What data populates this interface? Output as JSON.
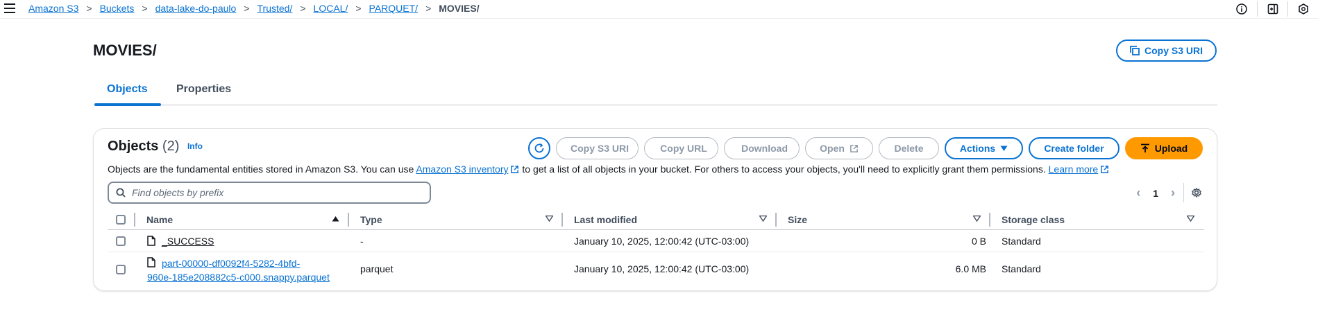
{
  "breadcrumbs": [
    {
      "label": "Amazon S3",
      "link": true
    },
    {
      "label": "Buckets",
      "link": true
    },
    {
      "label": "data-lake-do-paulo",
      "link": true
    },
    {
      "label": "Trusted/",
      "link": true
    },
    {
      "label": "LOCAL/",
      "link": true
    },
    {
      "label": "PARQUET/",
      "link": true
    },
    {
      "label": "MOVIES/",
      "link": false
    }
  ],
  "header": {
    "title": "MOVIES/",
    "copy_uri_label": "Copy S3 URI"
  },
  "tabs": [
    {
      "label": "Objects",
      "active": true
    },
    {
      "label": "Properties",
      "active": false
    }
  ],
  "objects": {
    "heading": "Objects",
    "count": "(2)",
    "info": "Info",
    "buttons": {
      "copy_s3_uri": "Copy S3 URI",
      "copy_url": "Copy URL",
      "download": "Download",
      "open": "Open",
      "delete": "Delete",
      "actions": "Actions",
      "create_folder": "Create folder",
      "upload": "Upload"
    },
    "description": {
      "part1": "Objects are the fundamental entities stored in Amazon S3. You can use ",
      "inventory_link": "Amazon S3 inventory",
      "part2": " to get a list of all objects in your bucket. For others to access your objects, you'll need to explicitly grant them permissions. ",
      "learn_more": "Learn more"
    },
    "search": {
      "placeholder": "Find objects by prefix",
      "value": ""
    },
    "pagination": {
      "page": "1"
    },
    "columns": {
      "name": "Name",
      "type": "Type",
      "last_modified": "Last modified",
      "size": "Size",
      "storage_class": "Storage class"
    },
    "rows": [
      {
        "name": "_SUCCESS",
        "type": "-",
        "last_modified": "January 10, 2025, 12:00:42 (UTC-03:00)",
        "size": "0 B",
        "storage_class": "Standard"
      },
      {
        "name_line1": "part-00000-df0092f4-5282-4bfd-",
        "name_line2": "960e-185e208882c5-c000.snappy.parquet",
        "type": "parquet",
        "last_modified": "January 10, 2025, 12:00:42 (UTC-03:00)",
        "size": "6.0 MB",
        "storage_class": "Standard"
      }
    ]
  },
  "icons": {
    "menu": "hamburger-icon",
    "info": "info-circle-icon",
    "notifications": "notification-panel-icon",
    "settings_top": "hexagon-settings-icon",
    "copy": "copy-icon",
    "refresh": "refresh-icon",
    "download": "download-icon",
    "external": "external-link-icon",
    "caret": "caret-down-icon",
    "upload": "upload-icon",
    "search": "search-icon",
    "gear": "gear-icon",
    "file": "file-icon"
  },
  "colors": {
    "link": "#0972d3",
    "primary": "#ff9900",
    "text": "#16191f",
    "disabled": "#8d99a8"
  }
}
